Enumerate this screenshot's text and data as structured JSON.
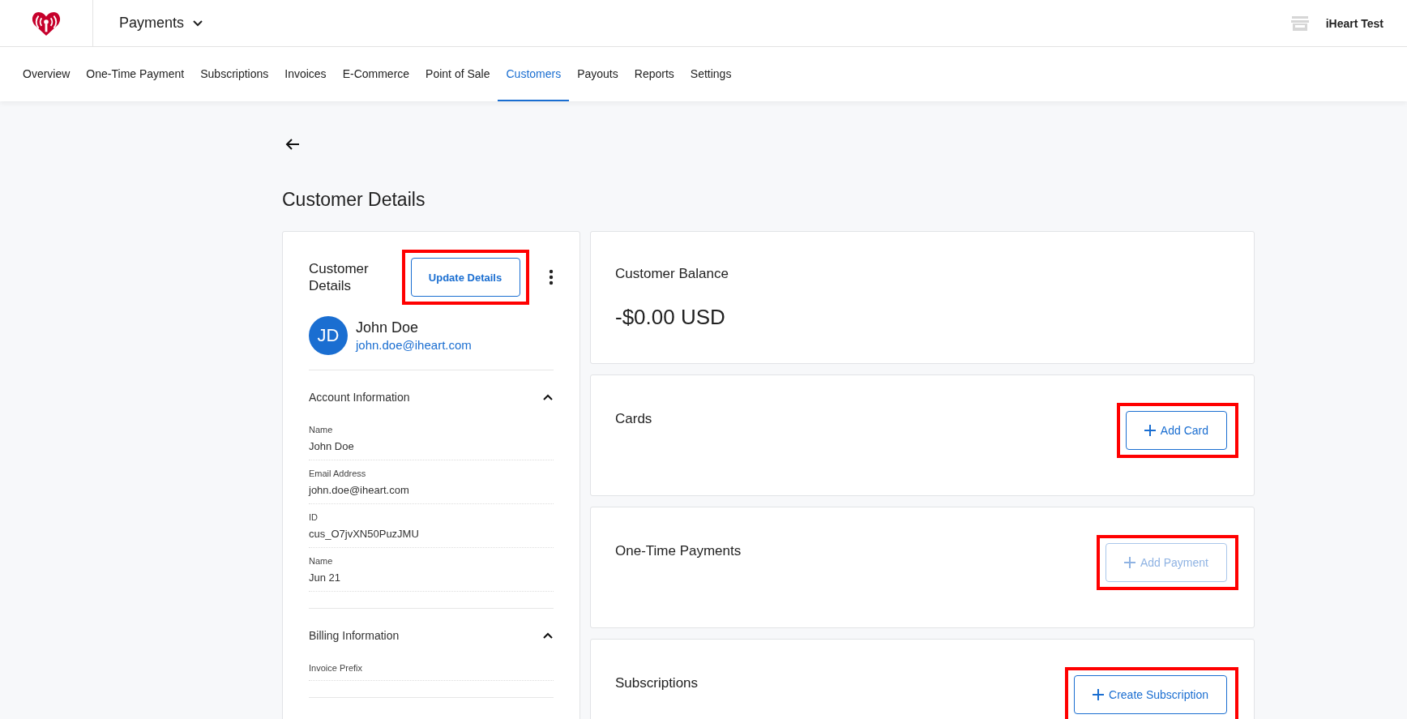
{
  "header": {
    "app_title": "Payments",
    "account": "iHeart Test"
  },
  "nav": [
    {
      "label": "Overview",
      "selected": false
    },
    {
      "label": "One-Time Payment",
      "selected": false
    },
    {
      "label": "Subscriptions",
      "selected": false
    },
    {
      "label": "Invoices",
      "selected": false
    },
    {
      "label": "E-Commerce",
      "selected": false
    },
    {
      "label": "Point of Sale",
      "selected": false
    },
    {
      "label": "Customers",
      "selected": true
    },
    {
      "label": "Payouts",
      "selected": false
    },
    {
      "label": "Reports",
      "selected": false
    },
    {
      "label": "Settings",
      "selected": false
    }
  ],
  "page_title": "Customer Details",
  "profile_card": {
    "title": "Customer Details",
    "update_button": {
      "label": "Update Details",
      "highlighted": true
    },
    "initials": "JD",
    "name": "John Doe",
    "email": "john.doe@iheart.com",
    "sections": [
      {
        "title": "Account Information",
        "expanded": true,
        "fields": [
          {
            "label": "Name",
            "value": "John Doe"
          },
          {
            "label": "Email Address",
            "value": "john.doe@iheart.com"
          },
          {
            "label": "ID",
            "value": "cus_O7jvXN50PuzJMU"
          },
          {
            "label": "Name",
            "value": "Jun 21"
          }
        ]
      },
      {
        "title": "Billing Information",
        "expanded": true,
        "fields": [
          {
            "label": "Invoice Prefix"
          }
        ]
      }
    ]
  },
  "right_cards": [
    {
      "kind": "balance",
      "title": "Customer Balance",
      "amount": "-$0.00 USD"
    },
    {
      "kind": "action",
      "title": "Cards",
      "button": {
        "label": "Add Card",
        "disabled": false,
        "highlighted": true
      }
    },
    {
      "kind": "action",
      "title": "One-Time Payments",
      "button": {
        "label": "Add Payment",
        "disabled": true,
        "highlighted": true
      }
    },
    {
      "kind": "action",
      "title": "Subscriptions",
      "button": {
        "label": "Create Subscription",
        "disabled": false,
        "highlighted": true
      }
    }
  ]
}
